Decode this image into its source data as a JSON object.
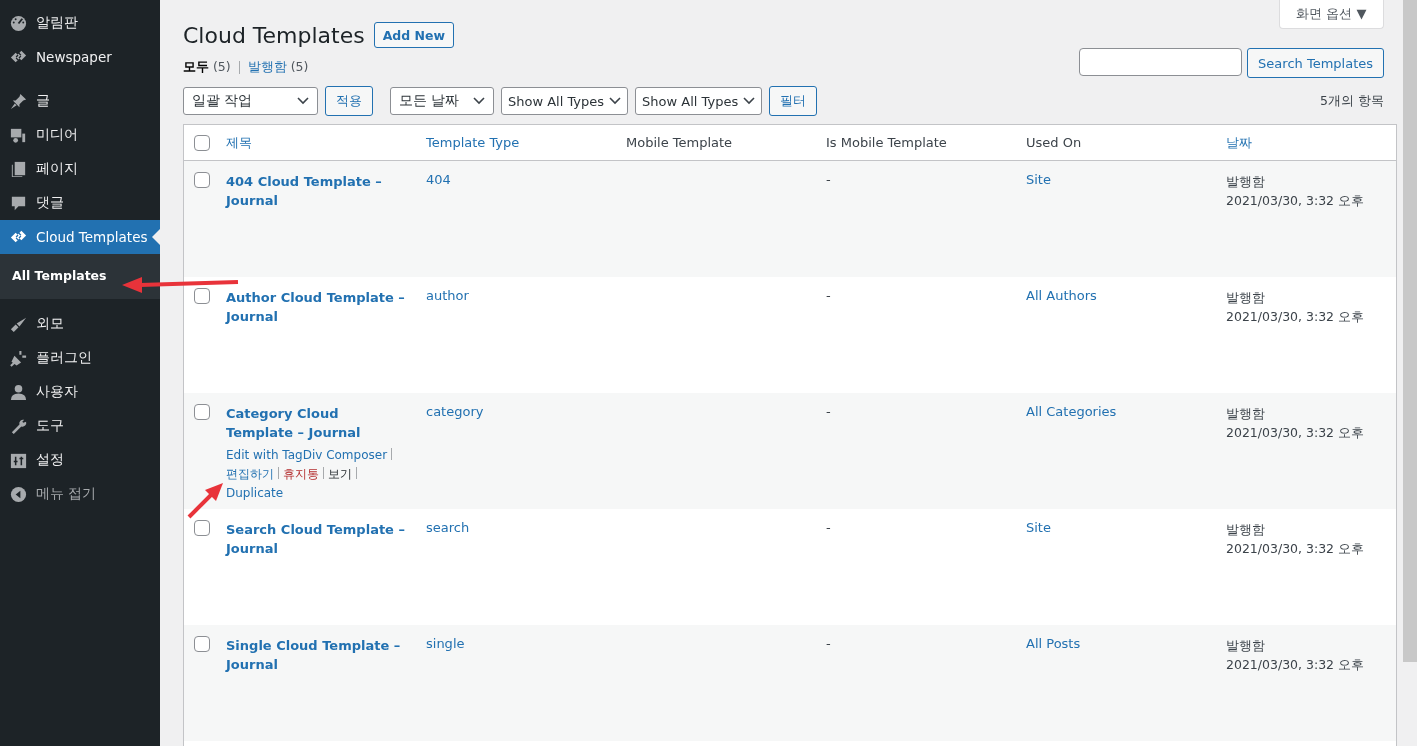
{
  "sidebar": {
    "items": [
      {
        "label": "알림판",
        "selected": false
      },
      {
        "label": "Newspaper",
        "selected": false
      },
      {
        "label": "글",
        "selected": false
      },
      {
        "label": "미디어",
        "selected": false
      },
      {
        "label": "페이지",
        "selected": false
      },
      {
        "label": "댓글",
        "selected": false
      },
      {
        "label": "Cloud Templates",
        "selected": true,
        "children": [
          {
            "label": "All Templates",
            "selected": true
          }
        ]
      },
      {
        "label": "외모",
        "selected": false
      },
      {
        "label": "플러그인",
        "selected": false
      },
      {
        "label": "사용자",
        "selected": false
      },
      {
        "label": "도구",
        "selected": false
      },
      {
        "label": "설정",
        "selected": false
      },
      {
        "label": "메뉴 접기",
        "selected": false,
        "muted": true
      }
    ]
  },
  "screen_options": "화면 옵션 ▼",
  "page_title": "Cloud Templates",
  "add_new": "Add New",
  "views": [
    {
      "label": "모두",
      "count": "(5)",
      "selected": true
    },
    {
      "label": "발행함",
      "count": "(5)",
      "selected": false
    }
  ],
  "search": {
    "button": "Search Templates"
  },
  "filters": {
    "bulk": "일괄 작업",
    "apply": "적용",
    "dates": "모든 날짜",
    "types": [
      "Show All Types",
      "Show All Types"
    ],
    "filter": "필터"
  },
  "item_count": "5개의 항목",
  "table": {
    "select_all_checked": false,
    "columns": [
      {
        "label": "제목",
        "sortable": true
      },
      {
        "label": "Template Type",
        "sortable": true
      },
      {
        "label": "Mobile Template",
        "sortable": false
      },
      {
        "label": "Is Mobile Template",
        "sortable": false
      },
      {
        "label": "Used On",
        "sortable": false
      },
      {
        "label": "날짜",
        "sortable": true
      }
    ],
    "rows": [
      {
        "title": "404 Cloud Template – Journal",
        "type": "404",
        "is_mobile": "-",
        "used_on": "Site",
        "status": "발행함",
        "date": "2021/03/30, 3:32 오후",
        "checked": false
      },
      {
        "title": "Author Cloud Template – Journal",
        "type": "author",
        "is_mobile": "-",
        "used_on": "All Authors",
        "status": "발행함",
        "date": "2021/03/30, 3:32 오후",
        "checked": false
      },
      {
        "title": "Category Cloud Template – Journal",
        "type": "category",
        "is_mobile": "-",
        "used_on": "All Categories",
        "status": "발행함",
        "date": "2021/03/30, 3:32 오후",
        "checked": false,
        "actions": [
          {
            "label": "Edit with TagDiv Composer",
            "kind": "link"
          },
          {
            "label": "편집하기",
            "kind": "link"
          },
          {
            "label": "휴지통",
            "kind": "danger"
          },
          {
            "label": "보기",
            "kind": "plain"
          },
          {
            "label": "Duplicate",
            "kind": "link"
          }
        ]
      },
      {
        "title": "Search Cloud Template – Journal",
        "type": "search",
        "is_mobile": "-",
        "used_on": "Site",
        "status": "발행함",
        "date": "2021/03/30, 3:32 오후",
        "checked": false
      },
      {
        "title": "Single Cloud Template – Journal",
        "type": "single",
        "is_mobile": "-",
        "used_on": "All Posts",
        "status": "발행함",
        "date": "2021/03/30, 3:32 오후",
        "checked": false
      }
    ]
  }
}
